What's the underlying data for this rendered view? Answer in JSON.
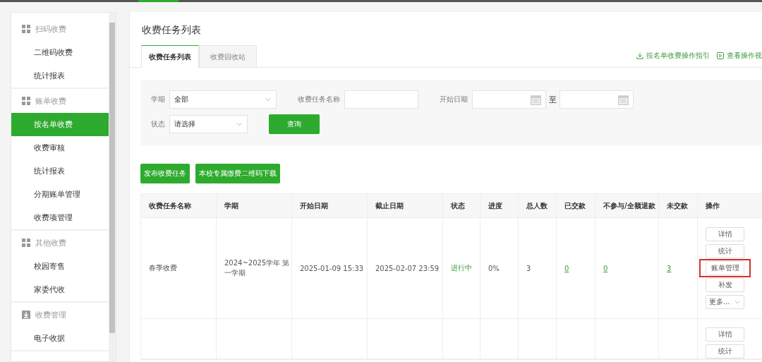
{
  "sidebar": {
    "groups": [
      {
        "title": "扫码收费",
        "kind": "grid",
        "items": [
          {
            "label": "二维码收费",
            "selected": false
          },
          {
            "label": "统计报表",
            "selected": false
          }
        ]
      },
      {
        "title": "账单收费",
        "kind": "grid",
        "items": [
          {
            "label": "按名单收费",
            "selected": true
          },
          {
            "label": "收费审核",
            "selected": false
          },
          {
            "label": "统计报表",
            "selected": false
          },
          {
            "label": "分期账单管理",
            "selected": false
          },
          {
            "label": "收费项管理",
            "selected": false
          }
        ]
      },
      {
        "title": "其他收费",
        "kind": "grid",
        "items": [
          {
            "label": "校园寄售",
            "selected": false
          },
          {
            "label": "家委代收",
            "selected": false
          }
        ]
      },
      {
        "title": "收费管理",
        "kind": "download",
        "items": [
          {
            "label": "电子收据",
            "selected": false
          }
        ]
      }
    ]
  },
  "main": {
    "title": "收费任务列表",
    "tabs": [
      {
        "label": "收费任务列表",
        "selected": true
      },
      {
        "label": "收费回收站",
        "selected": false
      }
    ],
    "links": [
      {
        "label": "按名单收费操作指引",
        "kind": "download"
      },
      {
        "label": "查看操作视",
        "kind": "video"
      }
    ],
    "filters": {
      "semester": {
        "label": "学期",
        "value": "全部"
      },
      "task_name": {
        "label": "收费任务名称"
      },
      "start_date": {
        "label": "开始日期",
        "separator": "至"
      },
      "status": {
        "label": "状态",
        "value": "请选择"
      },
      "query_button": "查询"
    },
    "buttons": [
      "发布收费任务",
      "本校专属缴费二维码下载"
    ],
    "table": {
      "columns": [
        "收费任务名称",
        "学期",
        "开始日期",
        "截止日期",
        "状态",
        "进度",
        "总人数",
        "已交款",
        "不参与/全额退款",
        "未交款",
        "操作"
      ],
      "rows": [
        {
          "cells": [
            {
              "text": "春季收费",
              "kind": "text"
            },
            {
              "text": "2024~2025学年 第一学期",
              "kind": "text"
            },
            {
              "text": "2025-01-09 15:33",
              "kind": "text"
            },
            {
              "text": "2025-02-07 23:59",
              "kind": "text"
            },
            {
              "text": "进行中",
              "kind": "status"
            },
            {
              "text": "0%",
              "kind": "text"
            },
            {
              "text": "3",
              "kind": "text"
            },
            {
              "text": "0",
              "kind": "link"
            },
            {
              "text": "0",
              "kind": "link"
            },
            {
              "text": "3",
              "kind": "link"
            }
          ],
          "actions": [
            {
              "label": "详情",
              "kind": "button",
              "highlighted": false
            },
            {
              "label": "统计",
              "kind": "button",
              "highlighted": false
            },
            {
              "label": "账单管理",
              "kind": "button",
              "highlighted": true
            },
            {
              "label": "补发",
              "kind": "button",
              "highlighted": false
            },
            {
              "label": "更多...",
              "kind": "dropdown",
              "highlighted": false
            }
          ]
        },
        {
          "cells": [],
          "actions": [
            {
              "label": "详情",
              "kind": "button",
              "highlighted": false
            },
            {
              "label": "统计",
              "kind": "button",
              "highlighted": false
            }
          ]
        }
      ]
    }
  }
}
